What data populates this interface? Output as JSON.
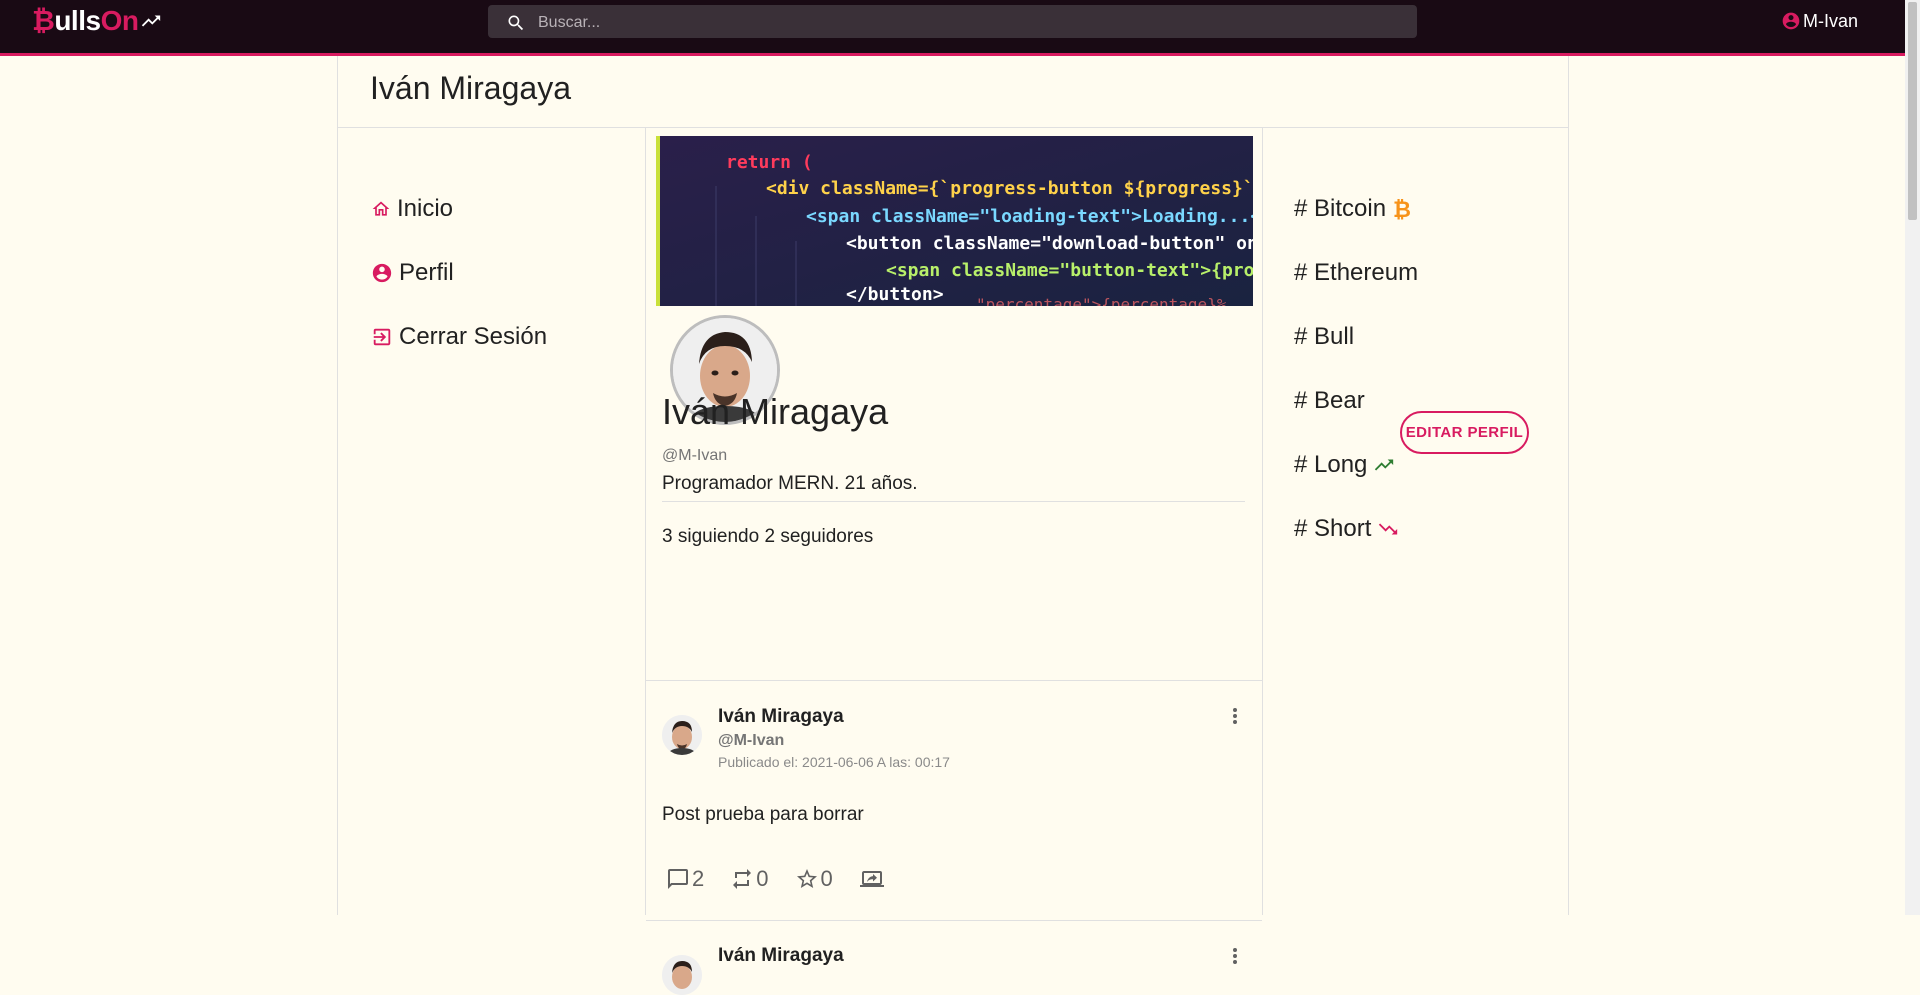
{
  "app": {
    "logo_b": "₿",
    "logo_white": "ulls",
    "logo_pink": "On",
    "accent_color": "#d81b60",
    "topbar_color": "#190a14",
    "background_color": "#fffcf0"
  },
  "search": {
    "placeholder": "Buscar..."
  },
  "user": {
    "username": "M-Ivan"
  },
  "page": {
    "title": "Iván Miragaya"
  },
  "nav": {
    "items": [
      {
        "label": "Inicio",
        "icon": "home-icon"
      },
      {
        "label": "Perfil",
        "icon": "account-circle-icon"
      },
      {
        "label": "Cerrar Sesión",
        "icon": "logout-icon"
      }
    ]
  },
  "profile": {
    "name": "Iván Miragaya",
    "handle": "@M-Ivan",
    "bio": "Programador MERN. 21 años.",
    "follow_text": "3 siguiendo 2 seguidores",
    "edit_button": "EDITAR PERFIL",
    "banner_code": [
      "return (",
      "<div className={`progress-button ${progress}`}>",
      "<span className=\"loading-text\">Loading...</span>",
      "<button className=\"download-button\" onClick={...}>",
      "<span className=\"button-text\">{progress ...}",
      "</button>",
      "\"percentage\">{percentage}%"
    ]
  },
  "posts": [
    {
      "name": "Iván Miragaya",
      "handle": "@M-Ivan",
      "date": "Publicado el: 2021-06-06 A las: 00:17",
      "text": "Post prueba para borrar",
      "comments": "2",
      "reposts": "0",
      "stars": "0"
    },
    {
      "name": "Iván Miragaya"
    }
  ],
  "tags": [
    {
      "label": "# Bitcoin",
      "icon": "bitcoin-icon",
      "icon_color": "#f7931a"
    },
    {
      "label": "# Ethereum"
    },
    {
      "label": "# Bull"
    },
    {
      "label": "# Bear"
    },
    {
      "label": "# Long",
      "icon": "trending-up-icon",
      "icon_color": "#2e7d32"
    },
    {
      "label": "# Short",
      "icon": "trending-down-icon",
      "icon_color": "#d81b60"
    }
  ]
}
